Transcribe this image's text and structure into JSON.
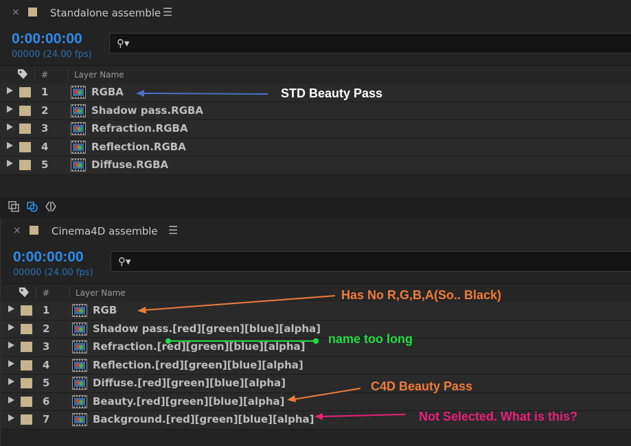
{
  "panels": [
    {
      "title": "Standalone assemble",
      "close_glyph": "×",
      "menu_glyph": "☰",
      "timecode": "0:00:00:00",
      "fps": "00000 (24.00 fps)",
      "search_placeholder": "",
      "columns": {
        "num": "#",
        "name": "Layer Name"
      },
      "rows": [
        {
          "num": "1",
          "name": "RGBA"
        },
        {
          "num": "2",
          "name": "Shadow pass.RGBA"
        },
        {
          "num": "3",
          "name": "Refraction.RGBA"
        },
        {
          "num": "4",
          "name": "Reflection.RGBA"
        },
        {
          "num": "5",
          "name": "Diffuse.RGBA"
        }
      ]
    },
    {
      "title": "Cinema4D assemble",
      "close_glyph": "×",
      "menu_glyph": "☰",
      "timecode": "0:00:00:00",
      "fps": "00000 (24.00 fps)",
      "search_placeholder": "",
      "columns": {
        "num": "#",
        "name": "Layer Name"
      },
      "rows": [
        {
          "num": "1",
          "name": "RGB"
        },
        {
          "num": "2",
          "name": "Shadow pass.[red][green][blue][alpha]"
        },
        {
          "num": "3",
          "name": "Refraction.[red][green][blue][alpha]"
        },
        {
          "num": "4",
          "name": "Reflection.[red][green][blue][alpha]"
        },
        {
          "num": "5",
          "name": "Diffuse.[red][green][blue][alpha]"
        },
        {
          "num": "6",
          "name": "Beauty.[red][green][blue][alpha]"
        },
        {
          "num": "7",
          "name": "Background.[red][green][blue][alpha]"
        }
      ]
    }
  ],
  "annotations": {
    "std_beauty": "STD Beauty Pass",
    "no_rgba": "Has No R,G,B,A(So.. Black)",
    "name_long": "name too long",
    "c4d_beauty": "C4D Beauty Pass",
    "not_selected": "Not Selected. What is this?"
  },
  "colors": {
    "accent": "#2d8ceb",
    "label_swatch": "#c5b48e",
    "annot_blue": "#4a72c8",
    "annot_orange": "#f07c3a",
    "annot_green": "#22dd44",
    "annot_pink": "#e8207a"
  },
  "icons": [
    "close-icon",
    "hamburger-menu-icon",
    "search-icon",
    "label-tag-icon",
    "footage-layer-icon",
    "toolbar-icons"
  ]
}
